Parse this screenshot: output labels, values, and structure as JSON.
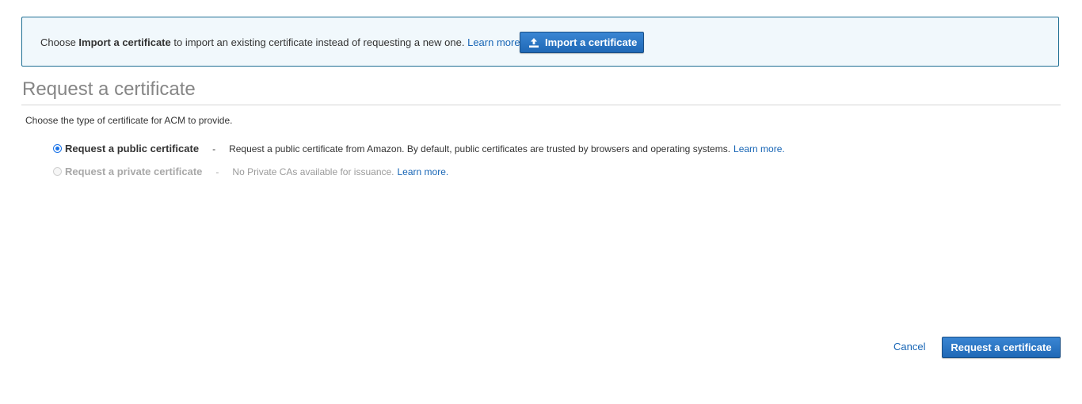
{
  "info_banner": {
    "prefix": "Choose ",
    "bold": "Import a certificate",
    "suffix": " to import an existing certificate instead of requesting a new one.",
    "learn_more": "Learn more.",
    "button_label": "Import a certificate",
    "button_icon": "upload-icon"
  },
  "page": {
    "title": "Request a certificate",
    "subtitle": "Choose the type of certificate for ACM to provide."
  },
  "options": [
    {
      "label": "Request a public certificate",
      "separator": "-",
      "description": "Request a public certificate from Amazon. By default, public certificates are trusted by browsers and operating systems.",
      "learn_more": "Learn more.",
      "selected": true,
      "disabled": false
    },
    {
      "label": "Request a private certificate",
      "separator": "-",
      "description": "No Private CAs available for issuance.",
      "learn_more": "Learn more.",
      "selected": false,
      "disabled": true
    }
  ],
  "footer": {
    "cancel_label": "Cancel",
    "submit_label": "Request a certificate"
  },
  "colors": {
    "accent": "#1f68b6",
    "link": "#1765b5",
    "banner_bg": "#f1f8fc",
    "banner_border": "#1f6f94"
  }
}
